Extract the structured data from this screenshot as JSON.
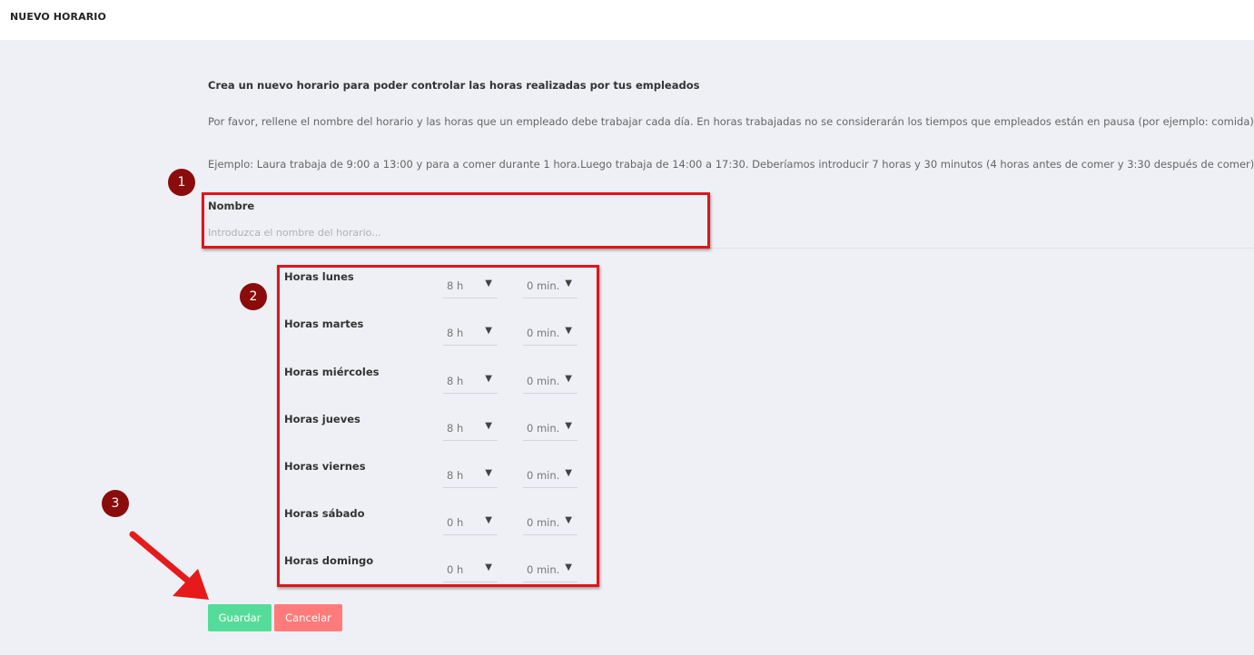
{
  "header": {
    "title": "NUEVO HORARIO"
  },
  "intro": {
    "heading": "Crea un nuevo horario para poder controlar las horas realizadas por tus empleados",
    "paragraph1": "Por favor, rellene el nombre del horario y las horas que un empleado debe trabajar cada día. En horas trabajadas no se considerarán los tiempos que empleados están en pausa (por ejemplo: comida)",
    "paragraph2": "Ejemplo: Laura trabaja de 9:00 a 13:00 y para a comer durante 1 hora.Luego trabaja de 14:00 a 17:30. Deberíamos introducir 7 horas y 30 minutos (4 horas antes de comer y 3:30 después de comer)"
  },
  "form": {
    "name_label": "Nombre",
    "name_value": "",
    "name_placeholder": "Introduzca el nombre del horario..."
  },
  "days": [
    {
      "label": "Horas lunes",
      "hours": "8 h",
      "minutes": "0 min."
    },
    {
      "label": "Horas martes",
      "hours": "8 h",
      "minutes": "0 min."
    },
    {
      "label": "Horas miércoles",
      "hours": "8 h",
      "minutes": "0 min."
    },
    {
      "label": "Horas jueves",
      "hours": "8 h",
      "minutes": "0 min."
    },
    {
      "label": "Horas viernes",
      "hours": "8 h",
      "minutes": "0 min."
    },
    {
      "label": "Horas sábado",
      "hours": "0 h",
      "minutes": "0 min."
    },
    {
      "label": "Horas domingo",
      "hours": "0 h",
      "minutes": "0 min."
    }
  ],
  "buttons": {
    "save": "Guardar",
    "cancel": "Cancelar"
  },
  "annotations": {
    "step1": "1",
    "step2": "2",
    "step3": "3"
  },
  "colors": {
    "background": "#eef0f5",
    "save": "#55dc9a",
    "cancel": "#ff7b7b",
    "highlight": "#e1141b",
    "badge": "#8b0c0c"
  }
}
